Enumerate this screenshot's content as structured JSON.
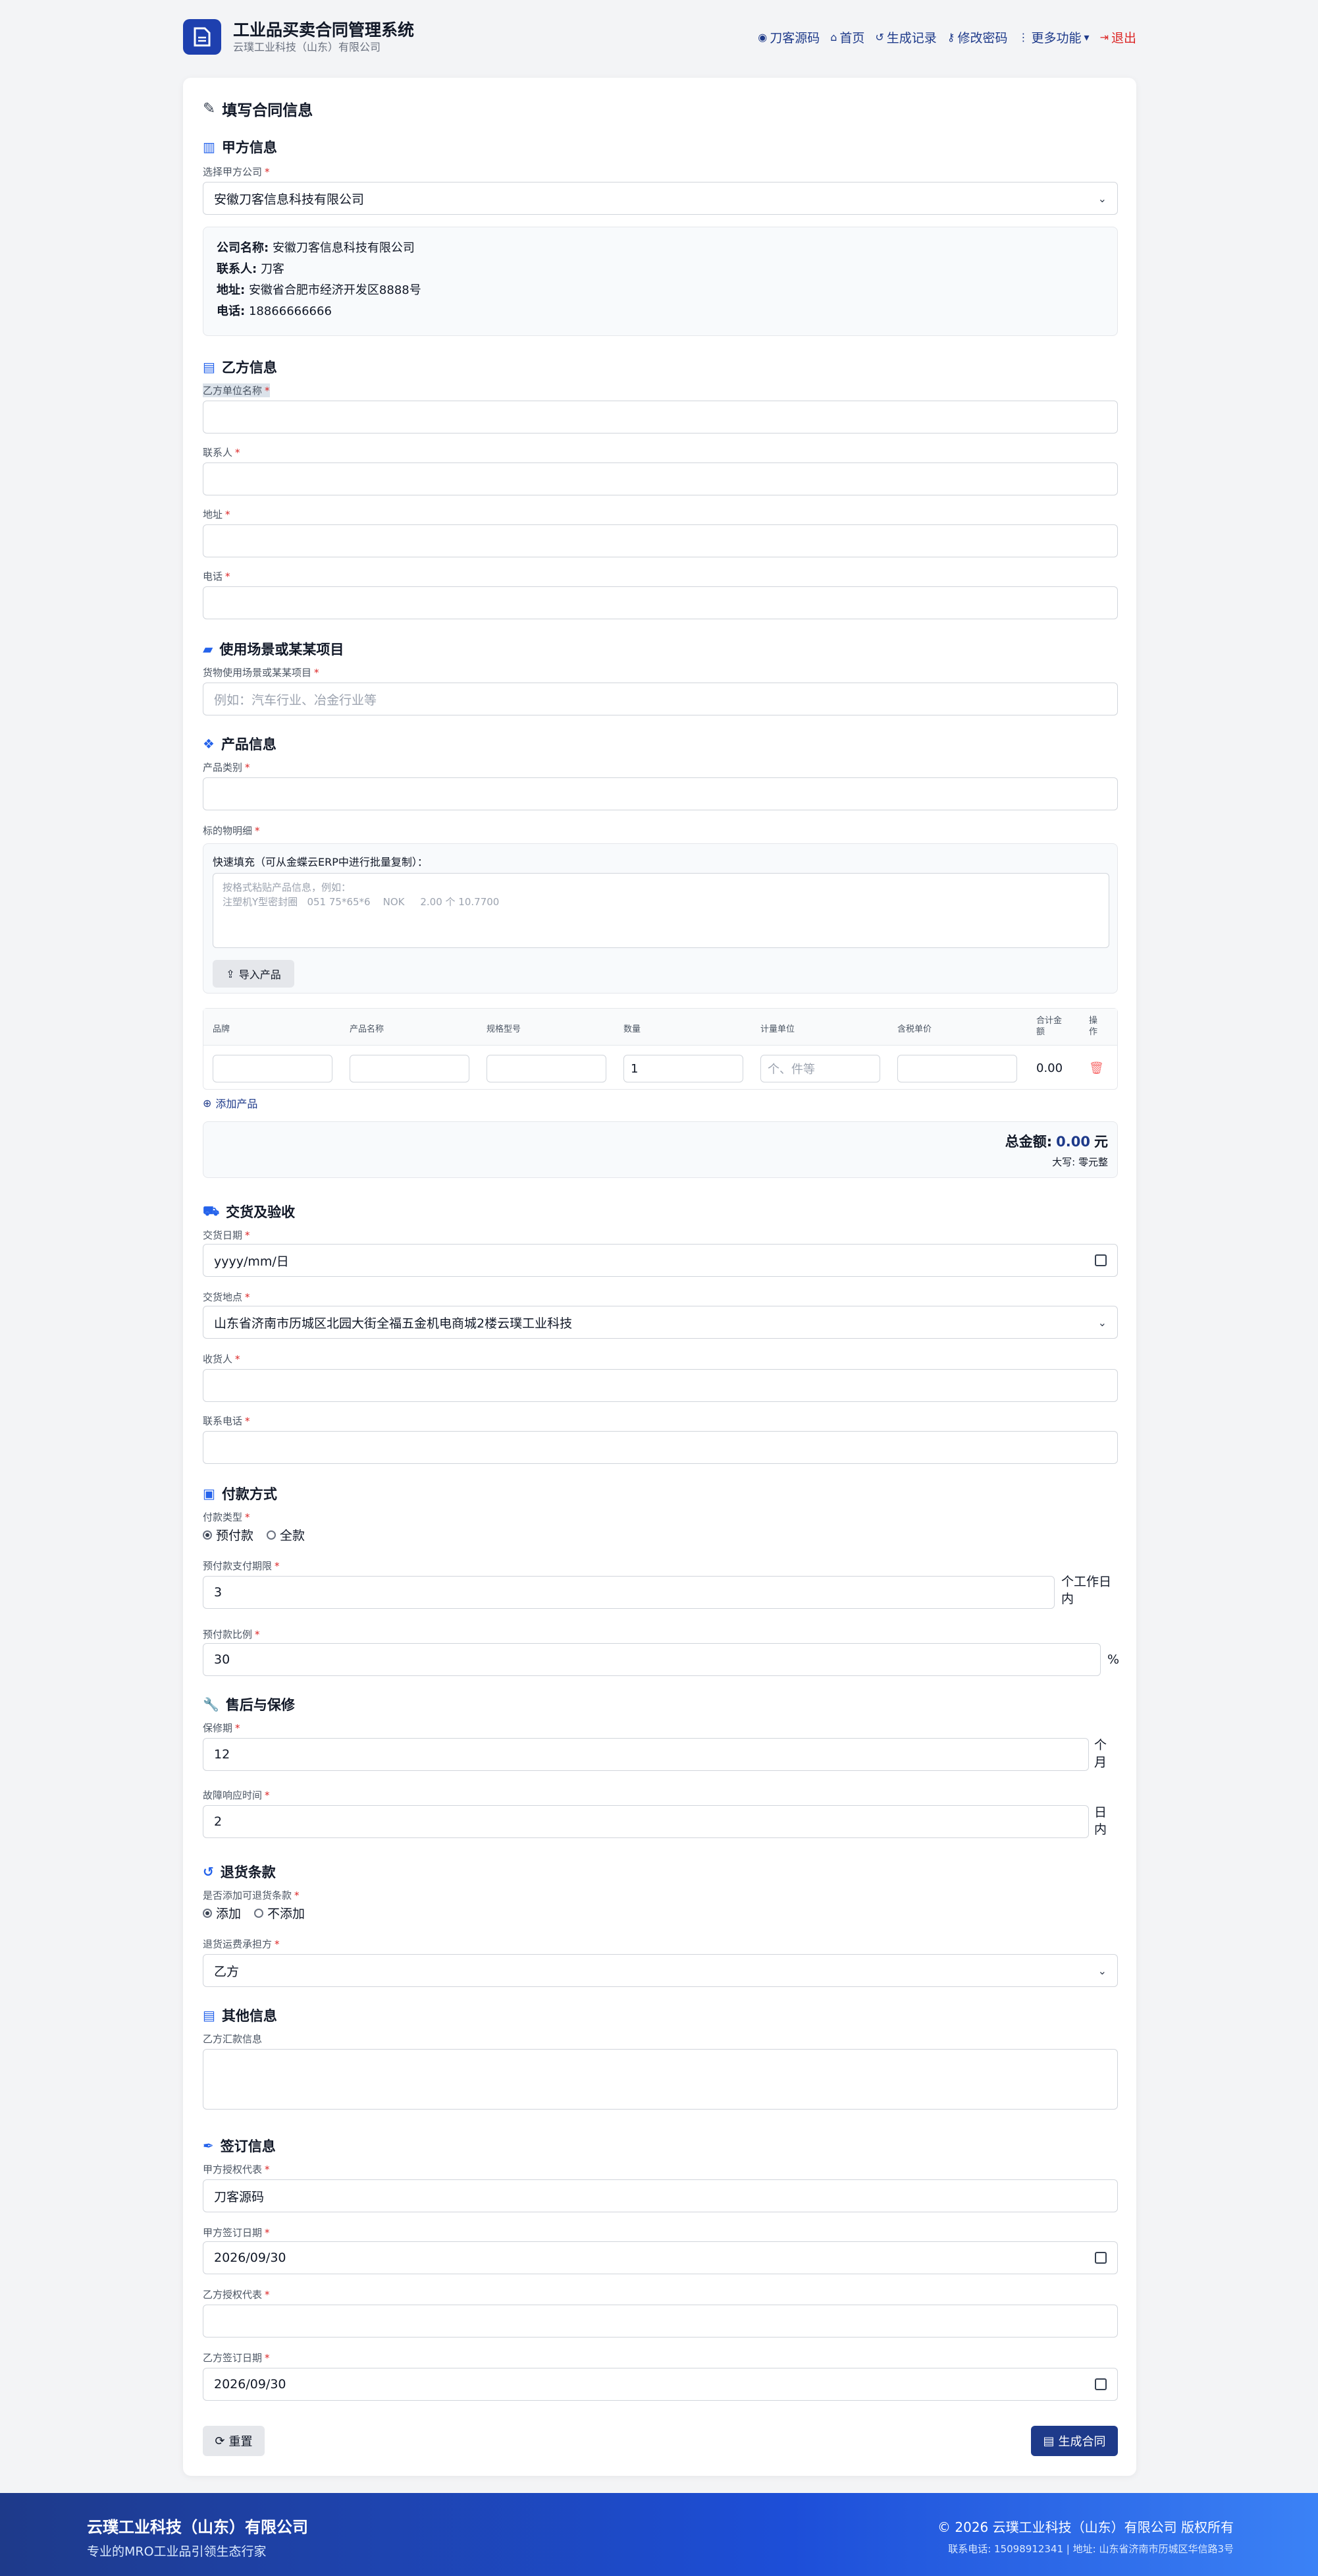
{
  "header": {
    "title": "工业品买卖合同管理系统",
    "subtitle": "云璞工业科技（山东）有限公司",
    "nav": {
      "source": "刀客源码",
      "home": "首页",
      "history": "生成记录",
      "password": "修改密码",
      "more": "更多功能",
      "logout": "退出"
    }
  },
  "form": {
    "title": "填写合同信息",
    "partyA": {
      "section": "甲方信息",
      "select_label": "选择甲方公司",
      "select_value": "安徽刀客信息科技有限公司",
      "info": {
        "name_label": "公司名称:",
        "name": "安徽刀客信息科技有限公司",
        "contact_label": "联系人:",
        "contact": "刀客",
        "address_label": "地址:",
        "address": "安徽省合肥市经济开发区8888号",
        "phone_label": "电话:",
        "phone": "18866666666"
      }
    },
    "partyB": {
      "section": "乙方信息",
      "name_label": "乙方单位名称",
      "contact_label": "联系人",
      "address_label": "地址",
      "phone_label": "电话"
    },
    "scene": {
      "section": "使用场景或某某项目",
      "label": "货物使用场景或某某项目",
      "placeholder": "例如：汽车行业、冶金行业等"
    },
    "product": {
      "section": "产品信息",
      "category_label": "产品类别",
      "detail_label": "标的物明细",
      "quick_label": "快速填充（可从金蝶云ERP中进行批量复制）：",
      "quick_placeholder_1": "按格式粘贴产品信息，例如：",
      "quick_placeholder_2": "注塑机Y型密封圈   051 75*65*6    NOK     2.00 个 10.7700",
      "import_btn": "导入产品",
      "columns": {
        "brand": "品牌",
        "name": "产品名称",
        "spec": "规格型号",
        "qty": "数量",
        "unit": "计量单位",
        "price": "含税单价",
        "total_1": "合计金",
        "total_2": "额",
        "op": "操作"
      },
      "row": {
        "qty": "1",
        "unit_placeholder": "个、件等",
        "total": "0.00"
      },
      "add_btn": "添加产品",
      "total_label": "总金额:",
      "total_amount": "0.00",
      "total_unit": "元",
      "capital_label": "大写:",
      "capital_value": "零元整"
    },
    "delivery": {
      "section": "交货及验收",
      "date_label": "交货日期",
      "date_placeholder": "yyyy/mm/日",
      "place_label": "交货地点",
      "place_value": "山东省济南市历城区北园大街全福五金机电商城2楼云璞工业科技",
      "receiver_label": "收货人",
      "receiver_phone_label": "联系电话"
    },
    "payment": {
      "section": "付款方式",
      "type_label": "付款类型",
      "opt_prepay": "预付款",
      "opt_full": "全款",
      "deadline_label": "预付款支付期限",
      "deadline_value": "3",
      "deadline_suffix_1": "个工作日",
      "deadline_suffix_2": "内",
      "ratio_label": "预付款比例",
      "ratio_value": "30",
      "ratio_suffix": "%"
    },
    "aftersale": {
      "section": "售后与保修",
      "warranty_label": "保修期",
      "warranty_value": "12",
      "warranty_suffix_1": "个",
      "warranty_suffix_2": "月",
      "response_label": "故障响应时间",
      "response_value": "2",
      "response_suffix_1": "日",
      "response_suffix_2": "内"
    },
    "returns": {
      "section": "退货条款",
      "add_label": "是否添加可退货条款",
      "opt_add": "添加",
      "opt_noadd": "不添加",
      "payer_label": "退货运费承担方",
      "payer_value": "乙方"
    },
    "other": {
      "section": "其他信息",
      "remit_label": "乙方汇款信息"
    },
    "sign": {
      "section": "签订信息",
      "a_rep_label": "甲方授权代表",
      "a_rep_value": "刀客源码",
      "a_date_label": "甲方签订日期",
      "a_date_value": "2026/09/30",
      "b_rep_label": "乙方授权代表",
      "b_date_label": "乙方签订日期",
      "b_date_value": "2026/09/30"
    },
    "reset_btn": "重置",
    "generate_btn": "生成合同"
  },
  "footer": {
    "company": "云璞工业科技（山东）有限公司",
    "slogan": "专业的MRO工业品引领生态行家",
    "copyright": "© 2026 云璞工业科技（山东）有限公司 版权所有",
    "contact": "联系电话: 15098912341 | 地址: 山东省济南市历城区华信路3号"
  },
  "colors": {
    "primary": "#1e3a8a",
    "danger": "#dc2626",
    "accent": "#2563eb"
  }
}
